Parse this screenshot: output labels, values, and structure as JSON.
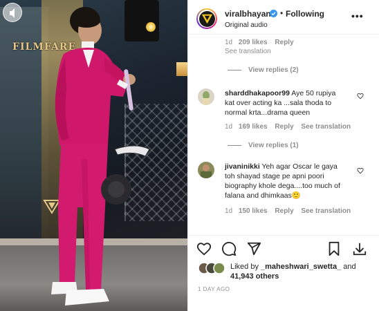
{
  "media": {
    "sign_text": "FILMFARE"
  },
  "header": {
    "username": "viralbhayani",
    "separator": "•",
    "follow_status": "Following",
    "audio_label": "Original audio",
    "more_icon": "more-horizontal-icon"
  },
  "comments": {
    "top_meta": {
      "time": "1d",
      "likes": "209 likes",
      "reply": "Reply",
      "translate": "See translation"
    },
    "view_replies_1": "View replies (2)",
    "items": [
      {
        "username": "sharddhakapoor99",
        "text": "Aye 50 rupiya kat over acting ka ...sala thoda to normal krta...drama queen",
        "time": "1d",
        "likes": "169 likes",
        "reply": "Reply",
        "translate": "See translation",
        "view_replies": "View replies (1)"
      },
      {
        "username": "jivaninikki",
        "text": "Yeh agar Oscar le gaya toh shayad stage pe apni poori biography khole dega....too much of falana and dhimkaas🙂",
        "time": "1d",
        "likes": "150 likes",
        "reply": "Reply",
        "translate": "See translation"
      }
    ]
  },
  "actions": {
    "like_icon": "heart-icon",
    "comment_icon": "comment-icon",
    "share_icon": "send-icon",
    "save_icon": "bookmark-icon",
    "download_icon": "download-icon"
  },
  "likes": {
    "prefix": "Liked by ",
    "user": "_maheshwari_swetta_",
    "and": " and",
    "others": "41,943 others"
  },
  "timestamp": "1 DAY AGO",
  "colors": {
    "verified": "#3897f0",
    "suit": "#d0186a",
    "meta_gray": "#8e8e8e"
  }
}
